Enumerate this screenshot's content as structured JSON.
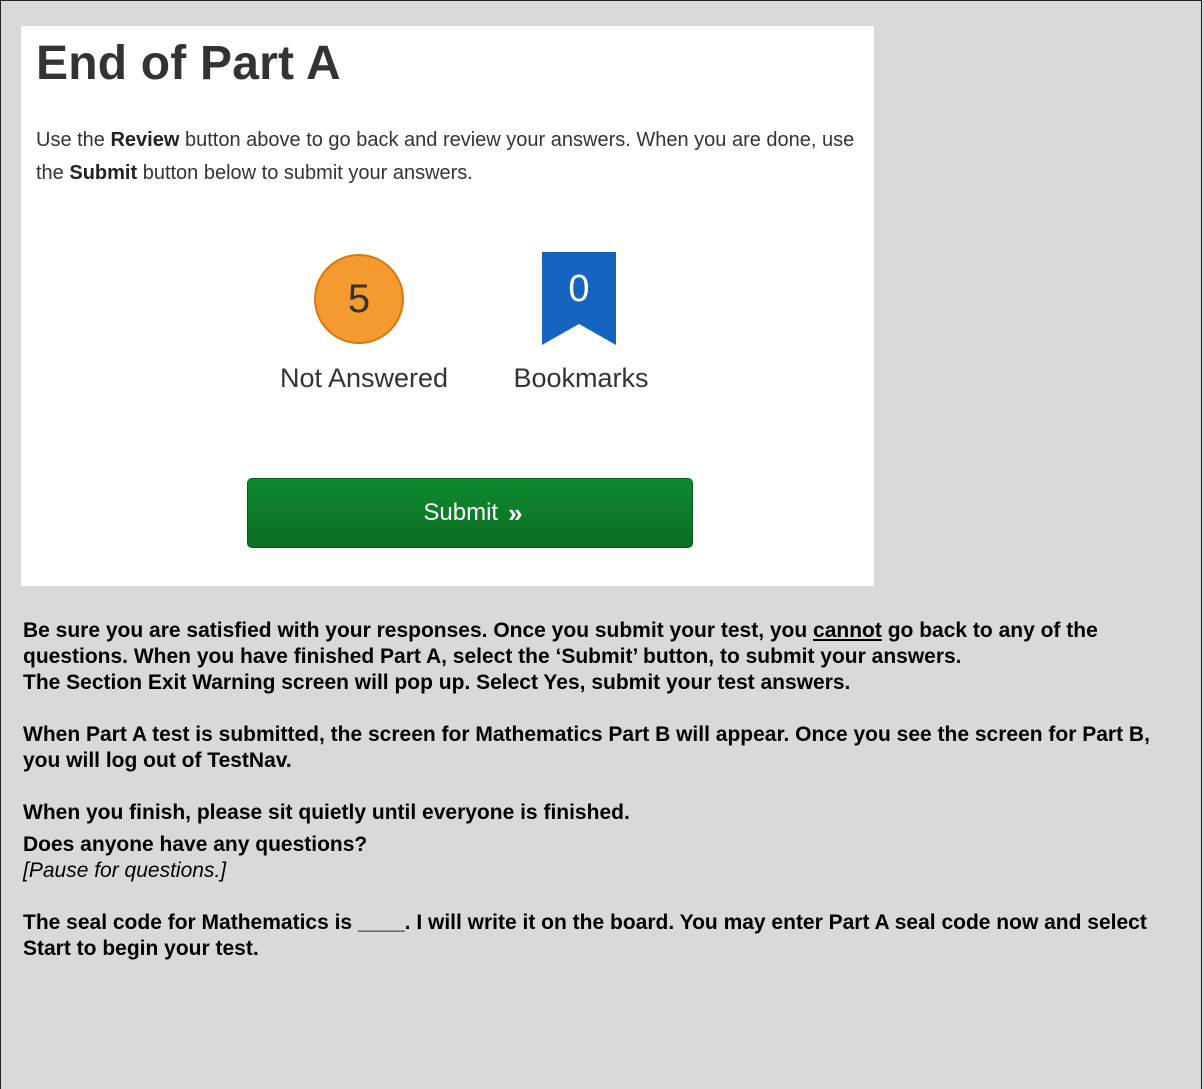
{
  "screenshot": {
    "title": "End of Part A",
    "instr_1": "Use the ",
    "instr_review": "Review",
    "instr_2": " button above to go back and review your answers. When you are done, use the ",
    "instr_submit": "Submit",
    "instr_3": " button below to submit your answers.",
    "not_answered_count": "5",
    "not_answered_label": "Not Answered",
    "bookmarks_count": "0",
    "bookmarks_label": "Bookmarks",
    "submit_label": "Submit",
    "submit_icon": "»",
    "colors": {
      "not_answered": "#f59a2e",
      "bookmark": "#1565c0",
      "submit": "#0f8a2d"
    }
  },
  "script": {
    "p1_a": "Be sure you are satisfied with your responses. Once you submit your test, you ",
    "p1_underline": "cannot",
    "p1_b": " go back to any of the questions. When you have finished Part A, select the ‘Submit’ button, to submit your answers.",
    "p2": "The Section Exit Warning screen will pop up. Select Yes, submit your test answers.",
    "p3": "When Part A test is submitted, the screen for Mathematics Part B will appear. Once you see the screen for Part B, you will log out of TestNav.",
    "p4": "When you finish, please sit quietly until everyone is finished.",
    "p5": "Does anyone have any questions?",
    "p6": "[Pause for questions.]",
    "p7": "The seal code for Mathematics is ____. I will write it on the board. You may enter Part A seal code now and select Start to begin your test."
  }
}
